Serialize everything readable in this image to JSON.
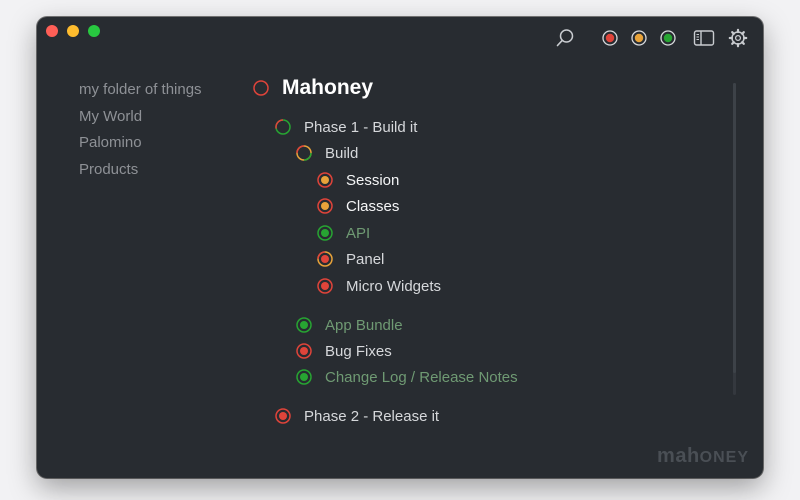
{
  "window": {
    "controls": [
      "close",
      "minimize",
      "zoom"
    ],
    "toolbar": {
      "icons": [
        "search-icon",
        "filter-red-icon",
        "filter-orange-icon",
        "filter-green-icon",
        "sidebar-toggle-icon",
        "gear-icon"
      ],
      "filter_colors": [
        "#e0443a",
        "#e8a33a",
        "#27a532"
      ]
    }
  },
  "colors": {
    "red": "#e0443a",
    "orange": "#e8a33a",
    "green": "#27a532",
    "track": "#3a3f45"
  },
  "sidebar": {
    "items": [
      {
        "label": "my folder of things"
      },
      {
        "label": "My World"
      },
      {
        "label": "Palomino"
      },
      {
        "label": "Products"
      }
    ]
  },
  "outline": {
    "title": "Mahoney",
    "items": [
      {
        "label": "Phase 1 - Build it",
        "status": "in-progress",
        "level": 1
      },
      {
        "label": "Build",
        "status": "in-progress",
        "level": 2
      },
      {
        "label": "Session",
        "status": "orange",
        "level": 3
      },
      {
        "label": "Classes",
        "status": "orange",
        "level": 3
      },
      {
        "label": "API",
        "status": "done",
        "level": 3
      },
      {
        "label": "Panel",
        "status": "red",
        "level": 3
      },
      {
        "label": "Micro Widgets",
        "status": "red",
        "level": 3
      },
      {
        "label": "App Bundle",
        "status": "done",
        "level": 2
      },
      {
        "label": "Bug Fixes",
        "status": "red",
        "level": 2
      },
      {
        "label": "Change Log / Release Notes",
        "status": "done",
        "level": 2
      },
      {
        "label": "Phase 2 - Release it",
        "status": "red",
        "level": 1
      }
    ]
  },
  "brand": {
    "name": "mahoney",
    "part1": "mah",
    "part2": "ONEY"
  }
}
